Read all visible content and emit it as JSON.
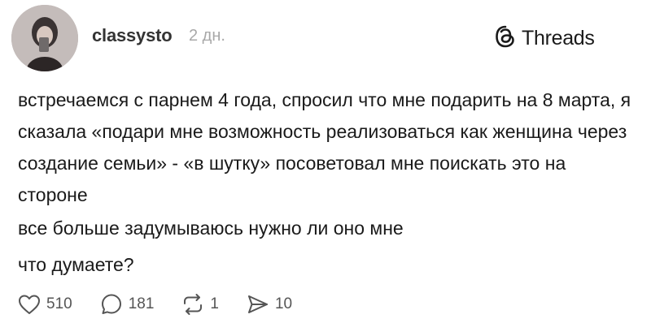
{
  "post": {
    "username": "classysto",
    "time": "2 дн.",
    "brand": "Threads",
    "paragraphs": [
      "встречаемся с парнем 4 года, спросил что мне подарить на 8 марта, я сказала «подари мне возможность реализоваться как женщина через создание семьи» - «в шутку» посоветовал мне поискать это на стороне",
      "все больше задумываюсь нужно ли оно мне",
      "что думаете?"
    ]
  },
  "actions": {
    "likes": "510",
    "comments": "181",
    "reposts": "1",
    "shares": "10"
  },
  "icons": {
    "like": "heart-icon",
    "comment": "comment-icon",
    "repost": "repost-icon",
    "share": "share-icon",
    "brand": "threads-logo-icon"
  }
}
